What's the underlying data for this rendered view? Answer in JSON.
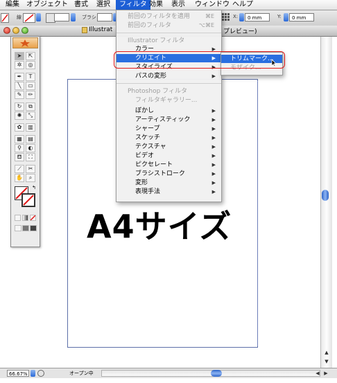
{
  "menubar": {
    "items": [
      {
        "label": "編集"
      },
      {
        "label": "オブジェクト"
      },
      {
        "label": "書式"
      },
      {
        "label": "選択"
      },
      {
        "label": "フィルタ"
      },
      {
        "label": "効果"
      },
      {
        "label": "表示"
      },
      {
        "label": "ウィンドウ"
      },
      {
        "label": "ヘルプ"
      }
    ],
    "active_index": 4,
    "accent_color": "#1d5fd6"
  },
  "controlbar": {
    "stroke_label": "線",
    "brush_label": "ブラシ",
    "x_label": "X:",
    "x_value": "0 mm",
    "y_label": "Y:",
    "y_value": "0 mm"
  },
  "document": {
    "title_left": "Illustrat",
    "title_right": "プレビュー)",
    "artwork_text": "A4サイズ",
    "zoom": "66.67%",
    "status_text": "オープン中"
  },
  "filter_menu": {
    "items": [
      {
        "label": "前回のフィルタを適用",
        "shortcut": "⌘E",
        "enabled": false
      },
      {
        "label": "前回のフィルタ",
        "shortcut": "⌥⌘E",
        "enabled": false
      },
      {
        "label": "Illustrator フィルタ",
        "is_header": true
      },
      {
        "label": "カラー",
        "submenu": true
      },
      {
        "label": "クリエイト",
        "submenu": true,
        "highlighted": true
      },
      {
        "label": "スタイライズ",
        "submenu": true
      },
      {
        "label": "パスの変形",
        "submenu": true
      },
      {
        "label": "Photoshop フィルタ",
        "is_header": true
      },
      {
        "label": "フィルタギャラリー...",
        "enabled": false
      },
      {
        "label": "ぼかし",
        "submenu": true
      },
      {
        "label": "アーティスティック",
        "submenu": true
      },
      {
        "label": "シャープ",
        "submenu": true
      },
      {
        "label": "スケッチ",
        "submenu": true
      },
      {
        "label": "テクスチャ",
        "submenu": true
      },
      {
        "label": "ビデオ",
        "submenu": true
      },
      {
        "label": "ピクセレート",
        "submenu": true
      },
      {
        "label": "ブラシストローク",
        "submenu": true
      },
      {
        "label": "変形",
        "submenu": true
      },
      {
        "label": "表現手法",
        "submenu": true
      }
    ]
  },
  "create_submenu": {
    "items": [
      {
        "label": "トリムマーク...",
        "highlighted": true
      },
      {
        "label": "モザイク...",
        "enabled": false
      }
    ]
  },
  "callout_color": "#e11919"
}
